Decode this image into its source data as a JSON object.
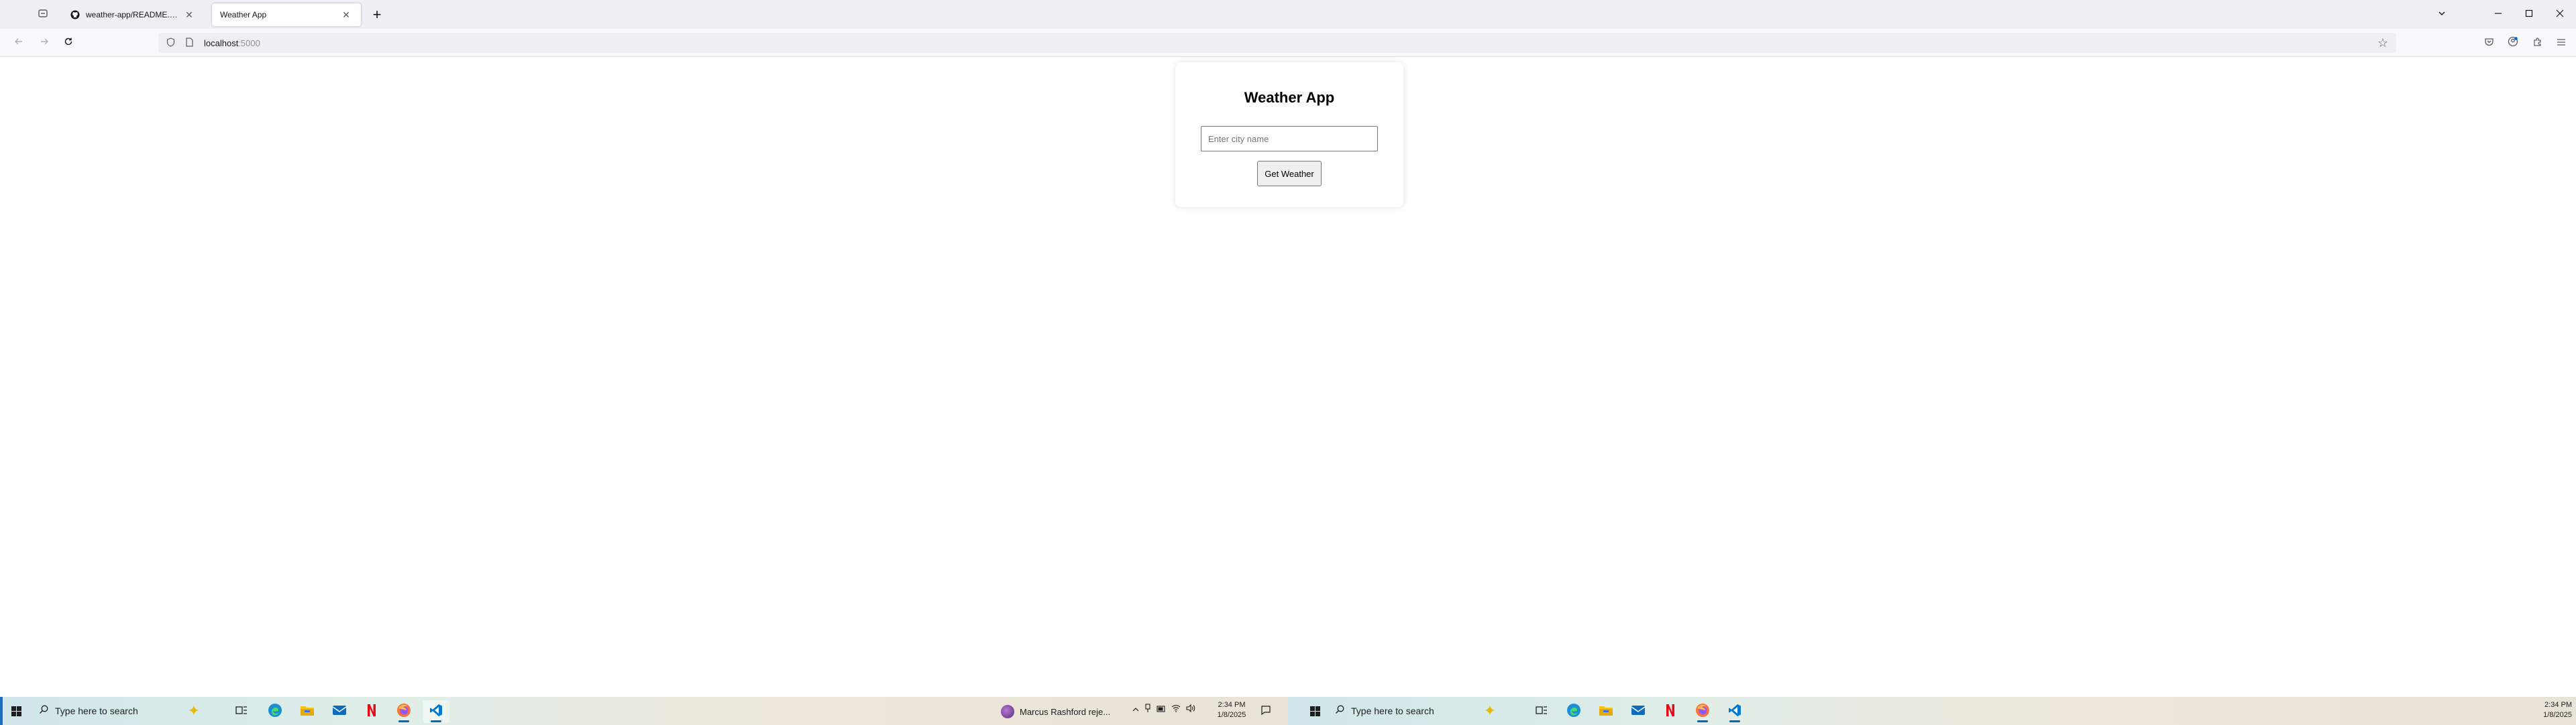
{
  "browser": {
    "tabs": [
      {
        "title": "weather-app/README.md at m",
        "favicon": "github-icon",
        "active": false
      },
      {
        "title": "Weather App",
        "favicon": "",
        "active": true
      }
    ],
    "url": {
      "host": "localhost",
      "port": ":5000"
    }
  },
  "app": {
    "title": "Weather App",
    "city_input": {
      "placeholder": "Enter city name",
      "value": ""
    },
    "get_weather_label": "Get Weather"
  },
  "taskbar_left": {
    "search_placeholder": "Type here to search",
    "news_text": "Marcus Rashford reje...",
    "time": "2:34 PM",
    "date": "1/8/2025"
  },
  "taskbar_right": {
    "search_placeholder": "Type here to search",
    "time": "2:34 PM",
    "date": "1/8/2025"
  },
  "colors": {
    "taskbar_accent": "#0067c0",
    "browser_chrome": "#f0f0f4"
  }
}
